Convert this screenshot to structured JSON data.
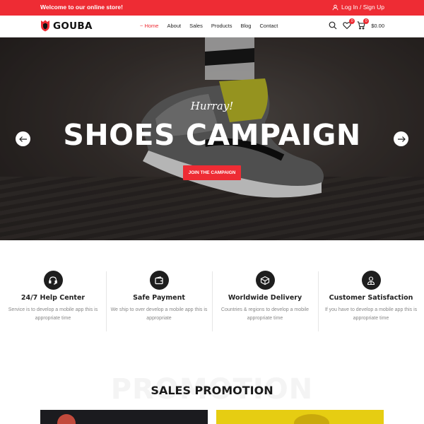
{
  "topbar": {
    "welcome": "Welcome to our online store!",
    "auth": "Log In / Sign Up"
  },
  "header": {
    "brand": "GOUBA",
    "nav": [
      {
        "label": "~ Home",
        "active": true
      },
      {
        "label": "About",
        "active": false
      },
      {
        "label": "Sales",
        "active": false
      },
      {
        "label": "Products",
        "active": false
      },
      {
        "label": "Blog",
        "active": false
      },
      {
        "label": "Contact",
        "active": false
      }
    ],
    "wishlist_count": "0",
    "cart_count": "0",
    "cart_total": "$0.00"
  },
  "hero": {
    "script": "Hurray!",
    "title": "SHOES CAMPAIGN",
    "cta": "JOIN THE CAMPAIGN"
  },
  "features": [
    {
      "icon": "headset-icon",
      "title": "24/7 Help Center",
      "desc": "Service is to develop a mobile app this is appropriate time"
    },
    {
      "icon": "wallet-icon",
      "title": "Safe Payment",
      "desc": "We ship to over develop a mobile app this is appropriate"
    },
    {
      "icon": "box-icon",
      "title": "Worldwide Delivery",
      "desc": "Countries & regions to develop a mobile appropriate time"
    },
    {
      "icon": "user-location-icon",
      "title": "Customer Satisfaction",
      "desc": "If you have to develop a mobile app this is appropriate time"
    }
  ],
  "promotion": {
    "ghost": "PROMOTION",
    "title": "SALES PROMOTION"
  },
  "colors": {
    "accent": "#ee2c34",
    "dark": "#1e1e1e"
  }
}
